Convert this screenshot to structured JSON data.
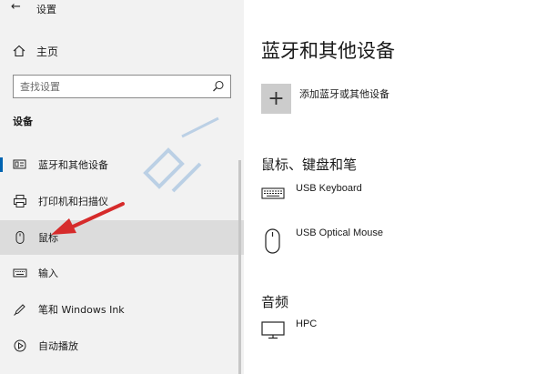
{
  "window": {
    "title": "设置"
  },
  "sidebar": {
    "home_label": "主页",
    "search_placeholder": "查找设置",
    "section_heading": "设备",
    "items": [
      {
        "label": "蓝牙和其他设备",
        "icon": "bluetooth-devices-icon",
        "selected": true
      },
      {
        "label": "打印机和扫描仪",
        "icon": "printer-icon"
      },
      {
        "label": "鼠标",
        "icon": "mouse-icon",
        "hovered": true
      },
      {
        "label": "输入",
        "icon": "keyboard-icon"
      },
      {
        "label": "笔和 Windows Ink",
        "icon": "pen-icon"
      },
      {
        "label": "自动播放",
        "icon": "autoplay-icon"
      }
    ]
  },
  "main": {
    "title": "蓝牙和其他设备",
    "add_device_label": "添加蓝牙或其他设备",
    "groups": [
      {
        "title": "鼠标、键盘和笔",
        "devices": [
          {
            "name": "USB Keyboard",
            "icon": "keyboard-icon"
          },
          {
            "name": "USB Optical Mouse",
            "icon": "mouse-icon"
          }
        ]
      },
      {
        "title": "音频",
        "devices": [
          {
            "name": "HPC",
            "icon": "monitor-icon"
          }
        ]
      }
    ]
  },
  "annotation": {
    "arrow_color": "#d62b2b"
  },
  "colors": {
    "accent": "#0063b1",
    "sidebar_bg": "#f2f2f2",
    "hover_bg": "#dcdcdc",
    "add_tile_bg": "#cccccc"
  }
}
